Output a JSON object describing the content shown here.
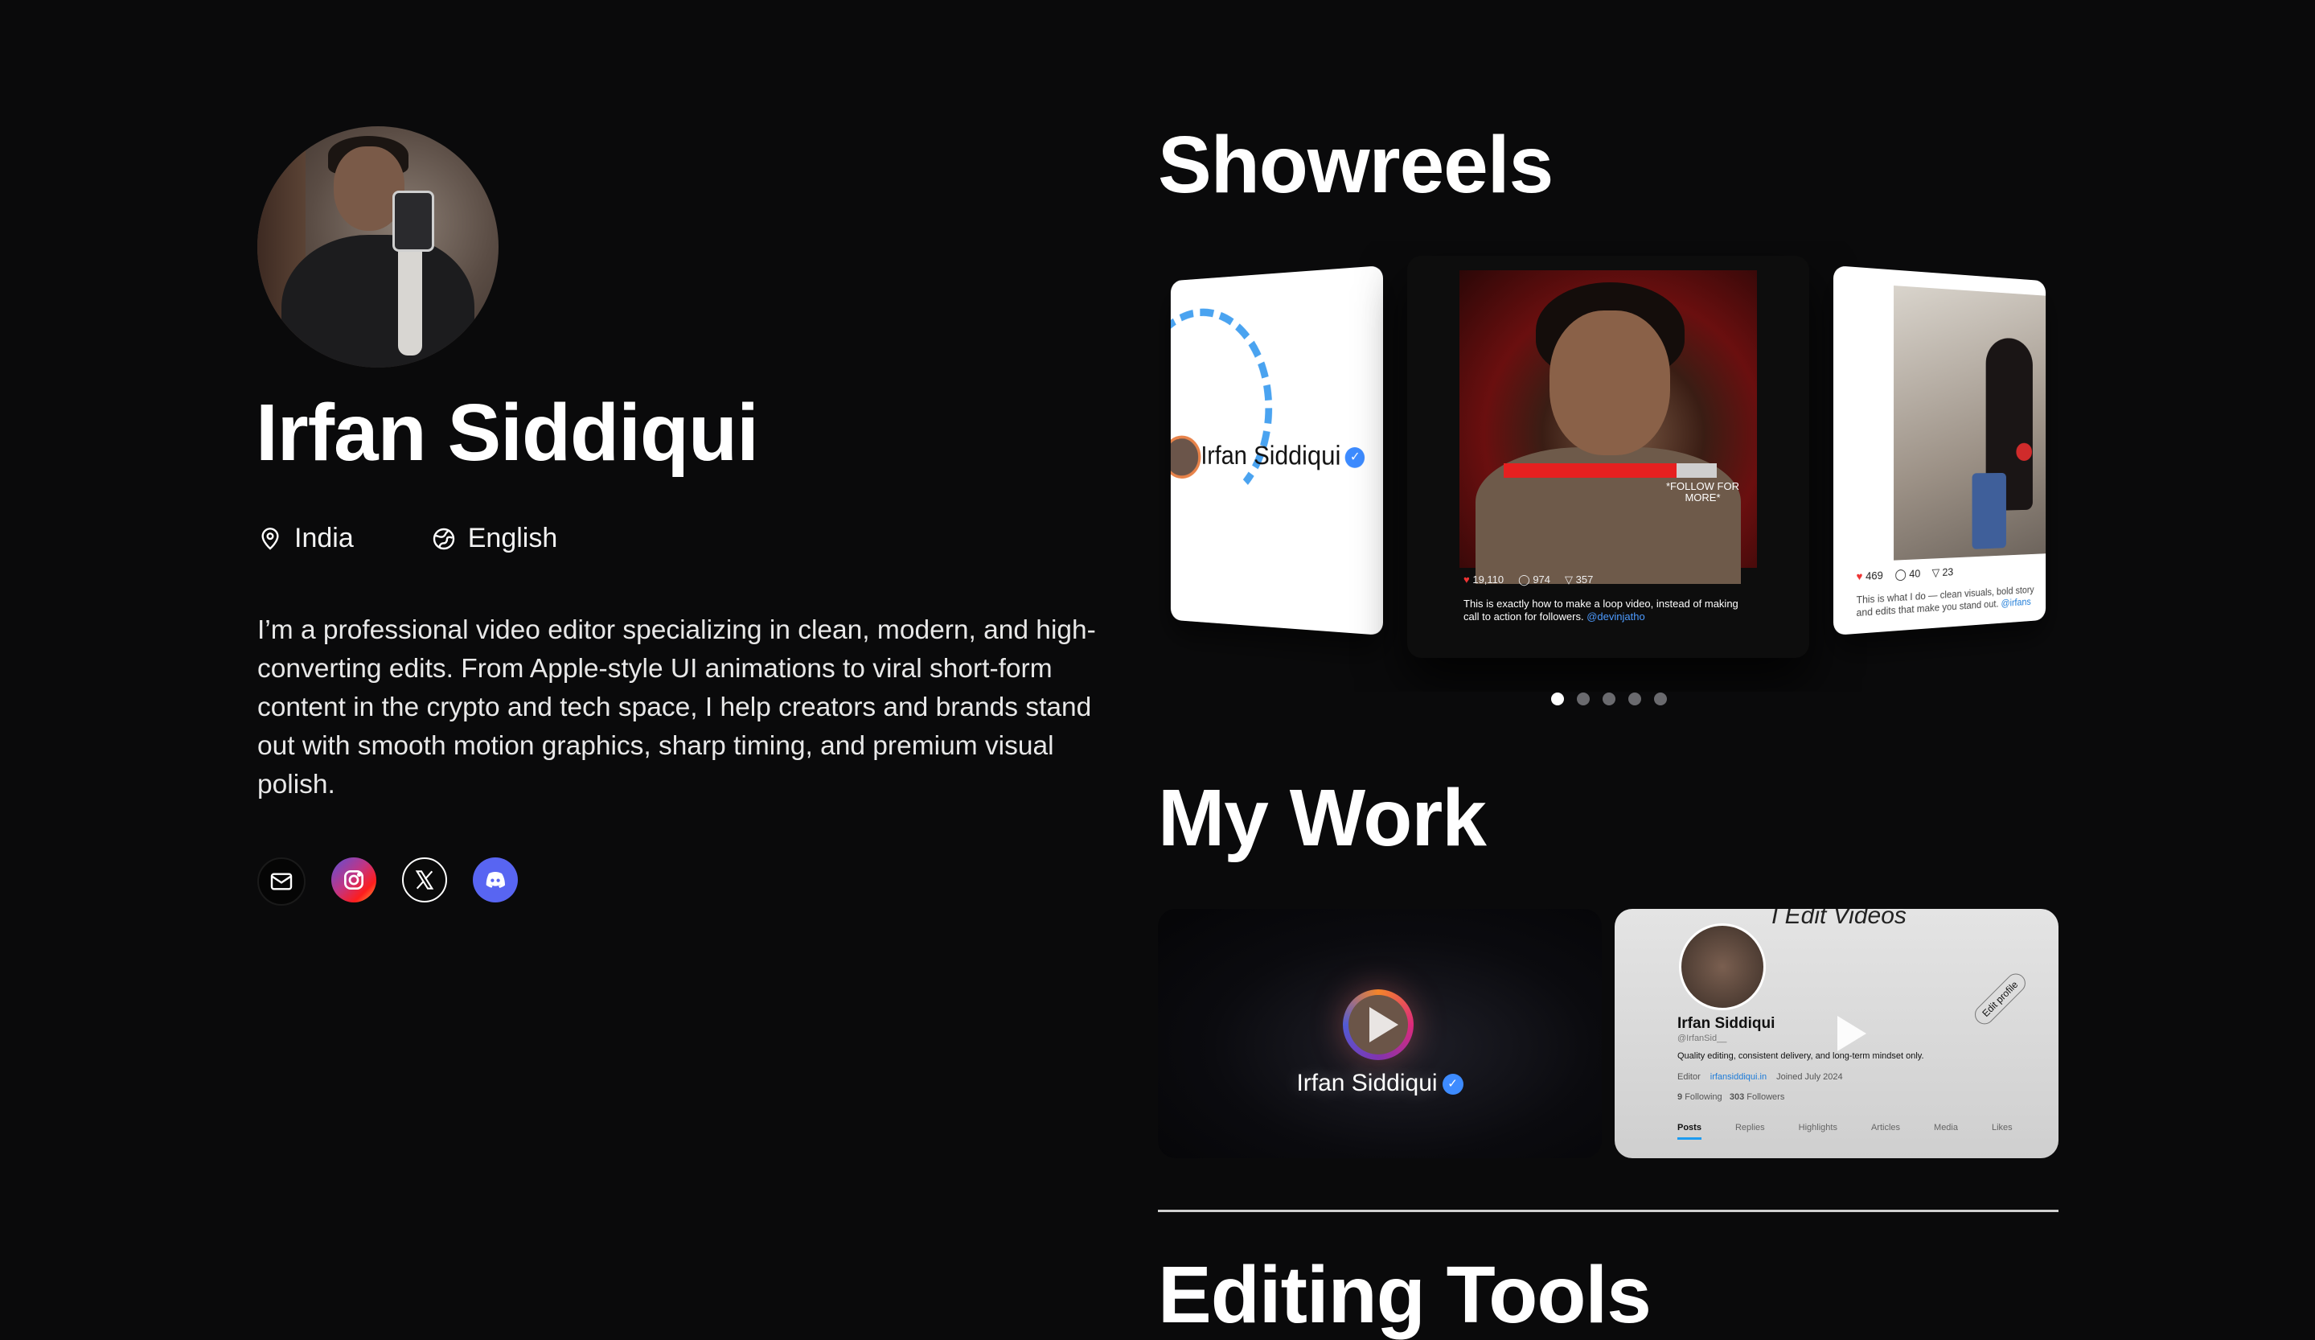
{
  "profile": {
    "name": "Irfan Siddiqui",
    "location": "India",
    "language": "English",
    "bio": "I’m a professional video editor specializing in clean, modern, and high-converting edits. From Apple-style UI animations to viral short-form content in the crypto and tech space, I help creators and brands stand out with smooth motion graphics, sharp timing, and premium visual polish.",
    "socials": [
      {
        "name": "email",
        "icon": "mail-icon"
      },
      {
        "name": "instagram",
        "icon": "instagram-icon"
      },
      {
        "name": "x",
        "icon": "x-icon"
      },
      {
        "name": "discord",
        "icon": "discord-icon"
      }
    ]
  },
  "showreels": {
    "title": "Showreels",
    "left_card": {
      "label": "Irfan Siddiqui"
    },
    "center_card": {
      "overlay": "*FOLLOW FOR MORE*",
      "likes": "19,110",
      "comments": "974",
      "shares": "357",
      "caption": "This is exactly how to make a loop video, instead of making call to action for followers.",
      "caption_tag": "@devinjatho"
    },
    "right_card": {
      "likes": "469",
      "comments": "40",
      "shares": "23",
      "caption": "This is what I do — clean visuals, bold story and edits that make you stand out.",
      "caption_tag": "@irfans"
    },
    "pagination": {
      "count": 5,
      "active": 0
    }
  },
  "my_work": {
    "title": "My Work",
    "card1": {
      "label": "Irfan Siddiqui"
    },
    "card2": {
      "scribble": "I Edit Videos",
      "name": "Irfan Siddiqui",
      "handle": "@IrfanSid__",
      "desc": "Quality editing, consistent delivery, and long-term mindset only.",
      "role": "Editor",
      "link": "irfansiddiqui.in",
      "joined": "Joined July 2024",
      "following_count": "9",
      "following_label": "Following",
      "followers_count": "303",
      "followers_label": "Followers",
      "edit_button": "Edit profile",
      "tabs": [
        "Posts",
        "Replies",
        "Highlights",
        "Articles",
        "Media",
        "Likes"
      ]
    }
  },
  "editing_tools": {
    "title": "Editing Tools"
  },
  "colors": {
    "background": "#0a0a0b",
    "accent_blue": "#4aa3f0",
    "discord": "#5865f2"
  }
}
